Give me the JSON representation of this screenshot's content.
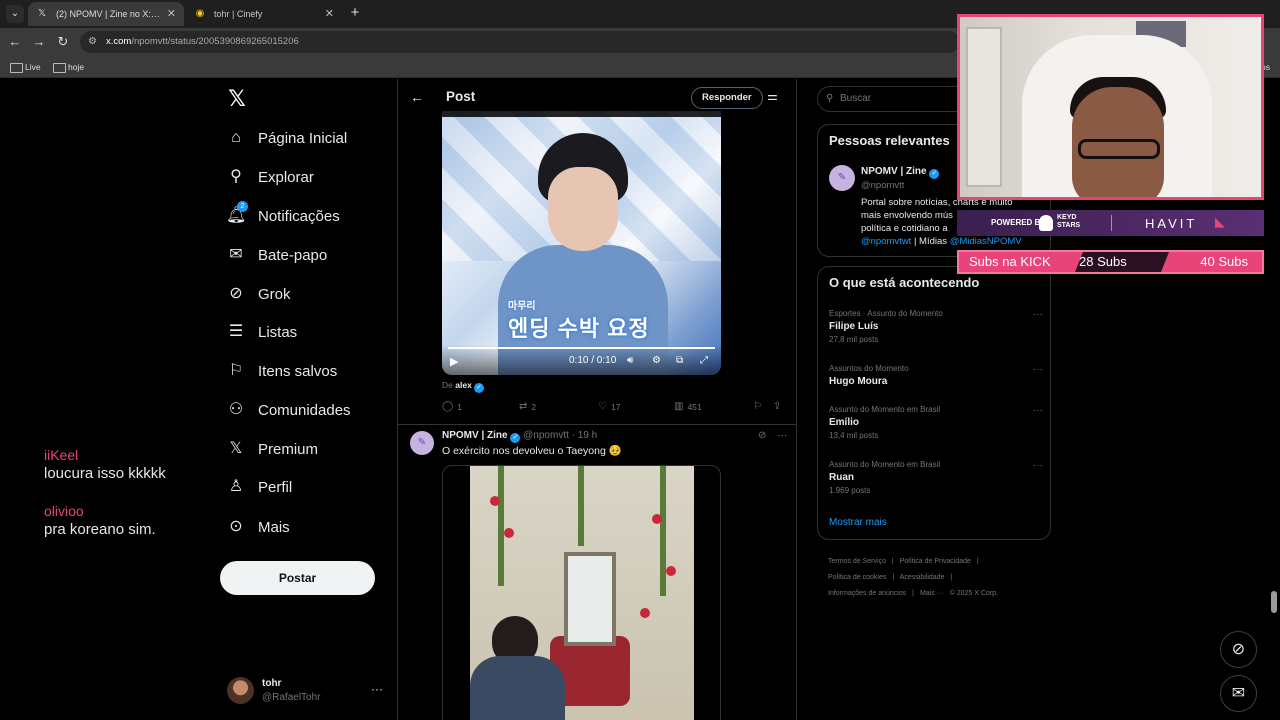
{
  "browser": {
    "tabs": [
      {
        "favicon": "x-logo-icon",
        "title": "(2) NPOMV | Zine no X: \"Um po",
        "active": true
      },
      {
        "favicon": "cinefy-icon",
        "title": "tohr | Cinefy",
        "active": false
      }
    ],
    "url_host": "x.com",
    "url_path": "/npomvtt/status/2005390869265015206",
    "bookmarks": [
      "Live",
      "hoje"
    ],
    "bookmarks_right": "rios"
  },
  "chat_overlay": [
    {
      "user": "iiKeel",
      "text": "loucura isso kkkkk"
    },
    {
      "user": "olivioo",
      "text": "pra koreano sim."
    }
  ],
  "nav": {
    "items": [
      {
        "icon": "home-icon",
        "label": "Página Inicial"
      },
      {
        "icon": "search-icon",
        "label": "Explorar"
      },
      {
        "icon": "bell-icon",
        "label": "Notificações",
        "badge": "2"
      },
      {
        "icon": "mail-icon",
        "label": "Bate-papo"
      },
      {
        "icon": "grok-icon",
        "label": "Grok"
      },
      {
        "icon": "list-icon",
        "label": "Listas"
      },
      {
        "icon": "bookmark-icon",
        "label": "Itens salvos"
      },
      {
        "icon": "communities-icon",
        "label": "Comunidades"
      },
      {
        "icon": "x-logo-icon",
        "label": "Premium"
      },
      {
        "icon": "user-icon",
        "label": "Perfil"
      },
      {
        "icon": "more-circle-icon",
        "label": "Mais"
      }
    ],
    "post_button": "Postar",
    "account": {
      "name": "tohr",
      "handle": "@RafaelTohr"
    }
  },
  "post_view": {
    "title": "Post",
    "reply_button": "Responder",
    "video1": {
      "caption_small": "마무리",
      "caption": "엔딩 수박 요정",
      "time": "0:10 / 0:10",
      "progress": 1.0
    },
    "from_prefix": "De",
    "from_user": "alex",
    "stats": {
      "replies": "1",
      "reposts": "2",
      "likes": "17",
      "views": "451"
    },
    "reply_tweet": {
      "name": "NPOMV | Zine",
      "handle": "@npomvtt",
      "time": "· 19 h",
      "text": "O exército nos devolveu o Taeyong 🥹"
    }
  },
  "sidebar": {
    "search_placeholder": "Buscar",
    "relevant": {
      "title": "Pessoas relevantes",
      "name": "NPOMV | Zine",
      "handle": "@npomvtt",
      "bio_lines": [
        "Portal sobre notícias, charts e muito",
        "mais envolvendo mús",
        "política e cotidiano a"
      ],
      "bio_link1": "@npomvtwt",
      "bio_sep": " | Mídias ",
      "bio_link2": "@MidiasNPOMV"
    },
    "trends_title": "O que está acontecendo",
    "trends": [
      {
        "category": "Esportes · Assunto do Momento",
        "name": "Filipe Luís",
        "count": "27,8 mil posts"
      },
      {
        "category": "Assuntos do Momento",
        "name": "Hugo Moura",
        "count": ""
      },
      {
        "category": "Assunto do Momento em Brasil",
        "name": "Emílio",
        "count": "13,4 mil posts"
      },
      {
        "category": "Assunto do Momento em Brasil",
        "name": "Ruan",
        "count": "1.969 posts"
      }
    ],
    "show_more": "Mostrar mais",
    "footer": [
      [
        "Termos de Serviço",
        "|",
        "Política de Privacidade",
        "|"
      ],
      [
        "Política de cookies",
        "|",
        "Acessibilidade",
        "|"
      ],
      [
        "Informações de anúncios",
        "|",
        "Mais ···",
        "© 2025 X Corp."
      ]
    ]
  },
  "stream_overlay": {
    "powered_by": "POWERED BY",
    "sponsor1_line1": "KEYD",
    "sponsor1_line2": "STARS",
    "sponsor2": "HAVIT",
    "subs_label": "Subs na KICK",
    "subs_current": "28 Subs",
    "subs_goal": "40 Subs",
    "subs_progress": 0.7
  },
  "colors": {
    "accent": "#1d9bf0",
    "stream_pink": "#e8447a",
    "background": "#000000"
  }
}
